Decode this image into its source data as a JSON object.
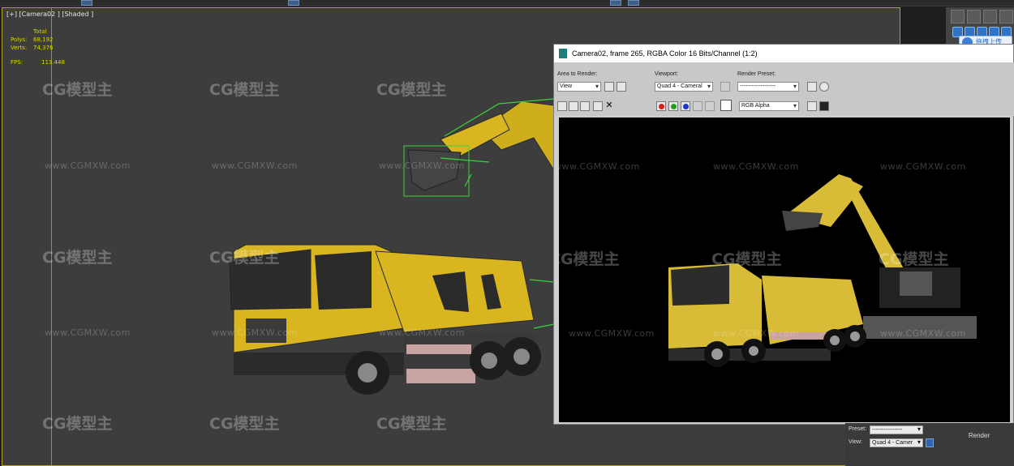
{
  "viewport": {
    "label": "[+] [Camera02 ] [Shaded ]",
    "stats": {
      "total_label": "Total",
      "polys_label": "Polys:",
      "polys_value": "68,192",
      "verts_label": "Verts:",
      "verts_value": "74,376",
      "fps_label": "FPS:",
      "fps_value": "113.448"
    }
  },
  "watermark": {
    "brand": "CG模型主",
    "url": "www.CGMXW.com"
  },
  "upload_button": {
    "label": "拖拽上传"
  },
  "render_window": {
    "title": "Camera02, frame 265, RGBA Color 16 Bits/Channel (1:2)",
    "area_to_render": {
      "label": "Area to Render:",
      "value": "View"
    },
    "viewport_select": {
      "label": "Viewport:",
      "value": "Quad 4 - Cameral"
    },
    "render_preset": {
      "label": "Render Preset:",
      "value": "-------------------"
    },
    "channel_select": {
      "value": "RGB Alpha"
    }
  },
  "render_setup": {
    "preset_label": "Preset:",
    "preset_value": "----------------",
    "view_label": "View:",
    "view_value": "Quad 4 - Camer",
    "render_button": "Render"
  },
  "colors": {
    "truck_yellow": "#d9b51f",
    "viewport_bg": "#3d3d3d",
    "selection_green": "#39d439",
    "viewport_border": "#b3a22e"
  }
}
